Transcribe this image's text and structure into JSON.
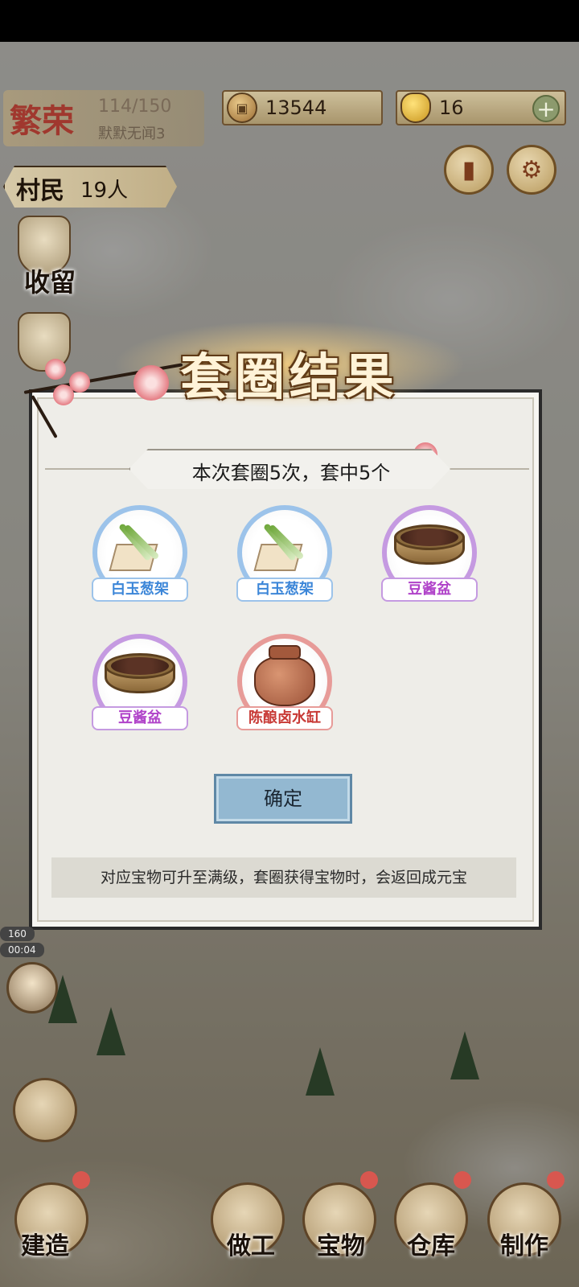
{
  "hud": {
    "prosperity_title": "繁荣",
    "prosperity_count": "114/150",
    "prosperity_sub": "默默无闻3",
    "coins": "13544",
    "gold": "16",
    "plus": "+",
    "villager_label": "村民",
    "villager_count": "19人"
  },
  "side": {
    "shelter_label": "收留"
  },
  "dialog": {
    "title": "套圈结果",
    "summary": "本次套圈5次，套中5个",
    "items": [
      {
        "name": "白玉葱架",
        "rarity": "blue"
      },
      {
        "name": "白玉葱架",
        "rarity": "blue"
      },
      {
        "name": "豆酱盆",
        "rarity": "purple"
      },
      {
        "name": "豆酱盆",
        "rarity": "purple"
      },
      {
        "name": "陈酿卤水缸",
        "rarity": "red"
      }
    ],
    "confirm": "确定",
    "note": "对应宝物可升至满级，套圈获得宝物时，会返回成元宝"
  },
  "status": {
    "timer_top": "160",
    "timer_bottom": "00:04"
  },
  "bottom_nav": {
    "build": "建造",
    "work": "做工",
    "treasure": "宝物",
    "warehouse": "仓库",
    "make": "制作"
  },
  "colors": {
    "rarity_blue": "#3c86d8",
    "rarity_purple": "#b043c9",
    "rarity_red": "#c83a36",
    "confirm_bg": "#93b8d1"
  }
}
